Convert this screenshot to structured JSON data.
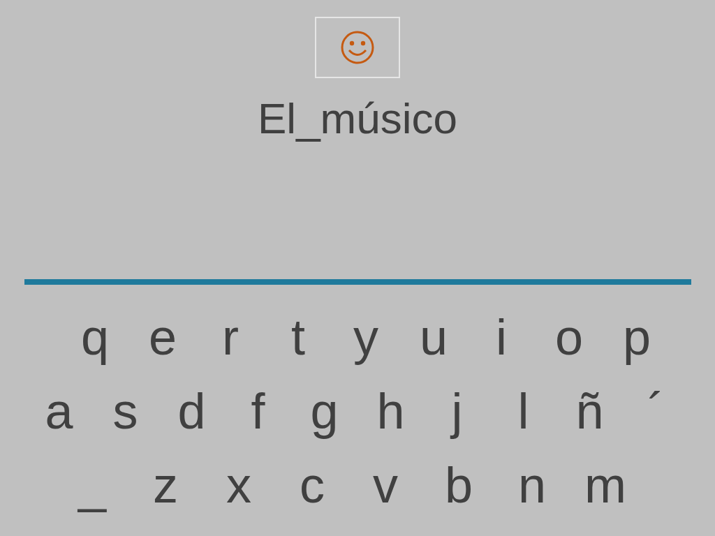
{
  "title": "El_músico",
  "keyboard": {
    "rows": [
      [
        "q",
        "e",
        "r",
        "t",
        "y",
        "u",
        "i",
        "o",
        "p"
      ],
      [
        "a",
        "s",
        "d",
        "f",
        "g",
        "h",
        "j",
        "l",
        "ñ",
        "´"
      ],
      [
        "_",
        "z",
        "x",
        "c",
        "v",
        "b",
        "n",
        "m"
      ]
    ]
  }
}
